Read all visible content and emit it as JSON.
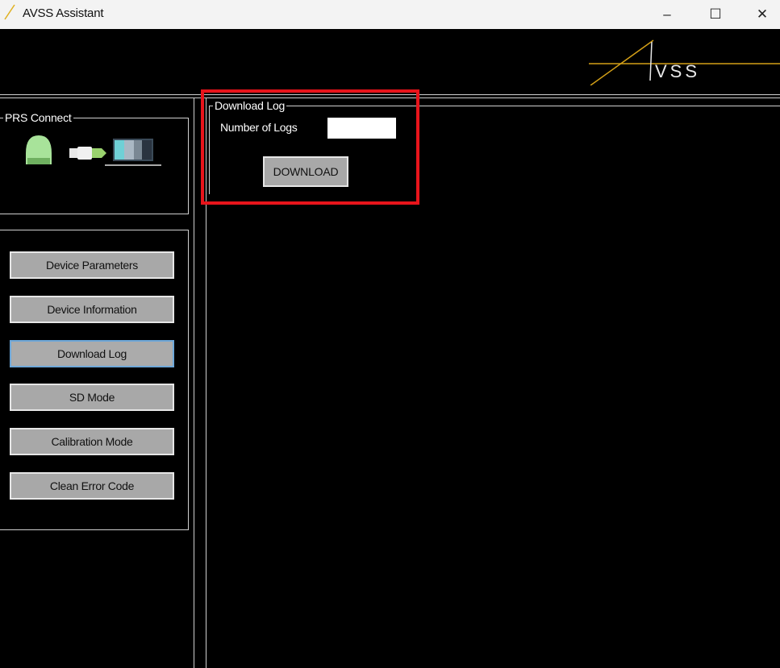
{
  "window": {
    "title": "AVSS Assistant",
    "minimize": "–",
    "maximize": "☐",
    "close": "✕"
  },
  "brand": {
    "logo_text": "VSS",
    "logo_color": "#d4a017"
  },
  "prs_connect": {
    "legend": "PRS Connect"
  },
  "nav": {
    "items": [
      {
        "label": "Device Parameters"
      },
      {
        "label": "Device Information"
      },
      {
        "label": "Download Log",
        "active": true
      },
      {
        "label": "SD Mode"
      },
      {
        "label": "Calibration Mode"
      },
      {
        "label": "Clean Error Code"
      }
    ]
  },
  "download_log": {
    "legend": "Download Log",
    "number_label": "Number of Logs",
    "number_value": "",
    "button_label": "DOWNLOAD"
  },
  "colors": {
    "highlight": "#e8141b",
    "background": "#000000",
    "button": "#a8a8a8",
    "active_border": "#6ea7d8"
  }
}
